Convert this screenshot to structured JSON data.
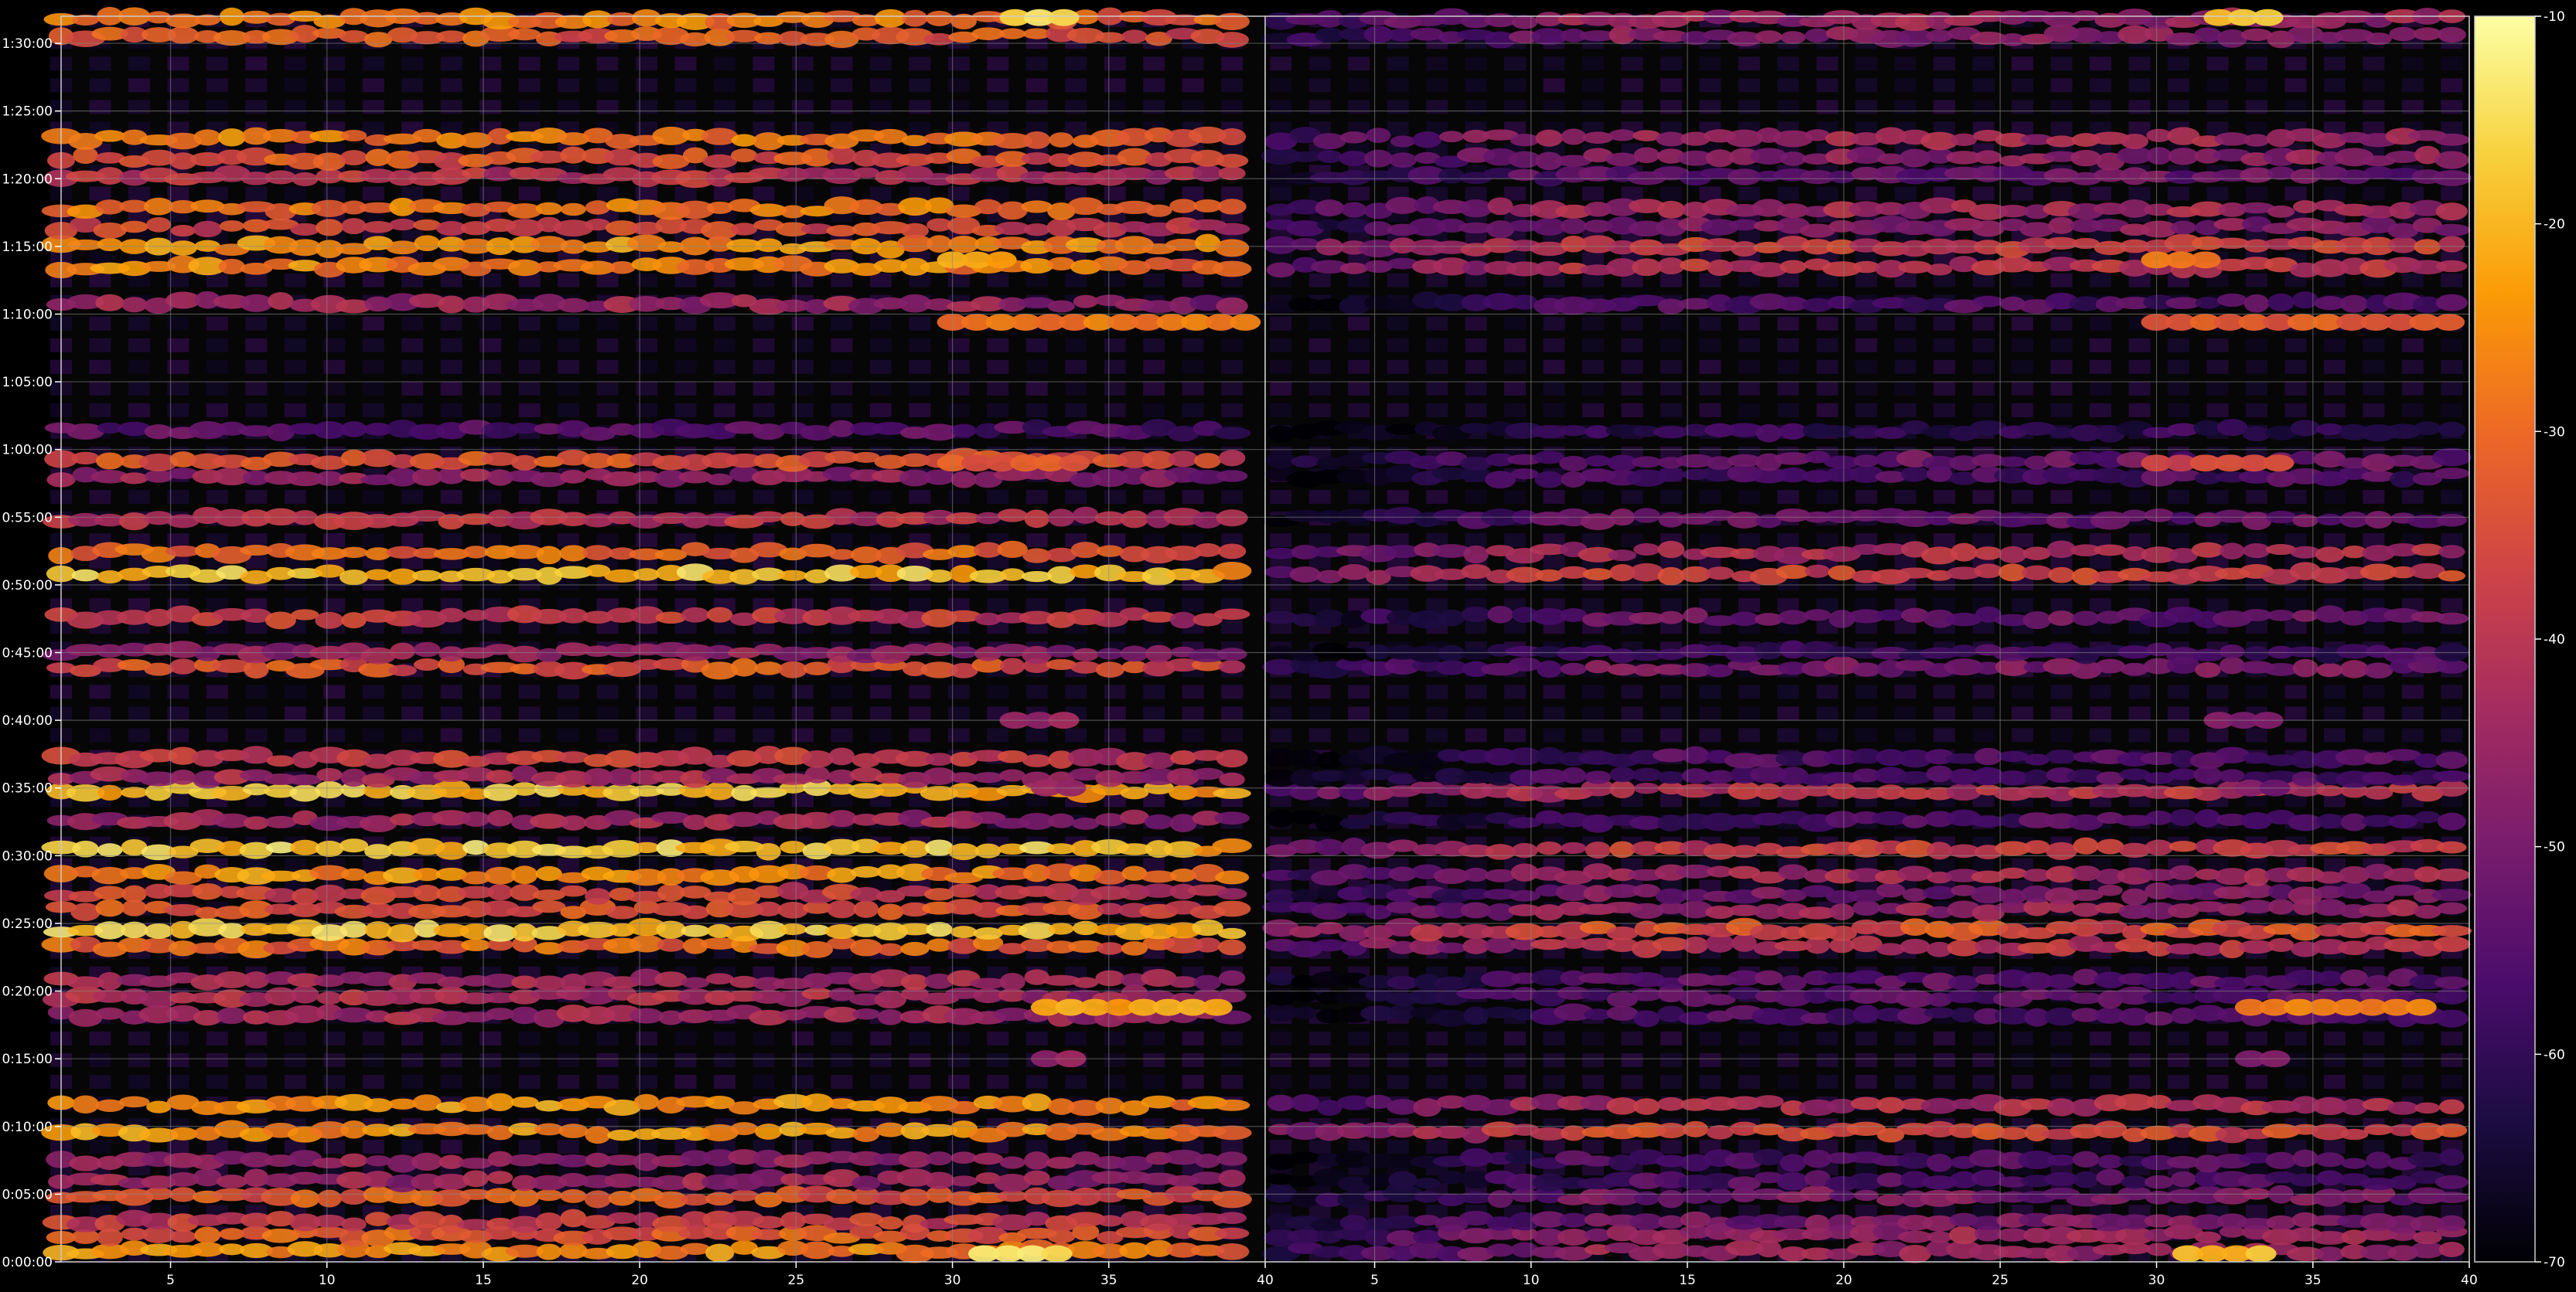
{
  "chart_data": {
    "type": "heatmap",
    "title": "",
    "xlabel": "",
    "ylabel": "",
    "grid": true,
    "colormap": [
      "#000004",
      "#1b0c41",
      "#4a0c6b",
      "#781c6d",
      "#a52c60",
      "#cf4446",
      "#ed6925",
      "#fb9b06",
      "#f7d13d",
      "#fcffa4"
    ],
    "background_color": "#000000",
    "grid_color": "#888888",
    "time_ticks": [
      "0:00:00",
      "0:05:00",
      "0:10:00",
      "0:15:00",
      "0:20:00",
      "0:25:00",
      "0:30:00",
      "0:35:00",
      "0:40:00",
      "0:45:00",
      "0:50:00",
      "0:55:00",
      "1:00:00",
      "1:05:00",
      "1:10:00",
      "1:15:00",
      "1:20:00",
      "1:25:00",
      "1:30:00"
    ],
    "time_range_minutes": [
      0,
      92
    ],
    "panels": [
      {
        "name": "left",
        "x_range": [
          1.5,
          40
        ],
        "x_ticks": [
          "5",
          "10",
          "15",
          "20",
          "25",
          "30",
          "35",
          "40"
        ],
        "active_range": [
          1.5,
          39.5
        ]
      },
      {
        "name": "right",
        "x_range": [
          1.5,
          40
        ],
        "x_ticks": [
          "5",
          "10",
          "15",
          "20",
          "25",
          "30",
          "35",
          "40"
        ],
        "active_range": [
          2,
          39.5
        ]
      }
    ],
    "colorbar": {
      "range": [
        -70,
        -10
      ],
      "ticks": [
        "-70",
        "-60",
        "-50",
        "-40",
        "-30",
        "-20",
        "-10"
      ]
    },
    "bands": [
      {
        "t": 0.8,
        "left": -25,
        "right": -45
      },
      {
        "t": 2.0,
        "left": -32,
        "right": -45
      },
      {
        "t": 3.0,
        "left": -38,
        "right": -50
      },
      {
        "t": 4.8,
        "left": -33,
        "right": -50
      },
      {
        "t": 6.0,
        "left": -45,
        "right": -56
      },
      {
        "t": 7.5,
        "left": -46,
        "right": -56
      },
      {
        "t": 9.6,
        "left": -24,
        "right": -36
      },
      {
        "t": 11.6,
        "left": -24,
        "right": -42
      },
      {
        "t": 18.2,
        "left": -44,
        "right": -56
      },
      {
        "t": 19.6,
        "left": -42,
        "right": -54
      },
      {
        "t": 20.8,
        "left": -43,
        "right": -54
      },
      {
        "t": 23.3,
        "left": -30,
        "right": -40
      },
      {
        "t": 24.5,
        "left": -17,
        "right": -34
      },
      {
        "t": 26.0,
        "left": -33,
        "right": -45
      },
      {
        "t": 27.2,
        "left": -37,
        "right": -50
      },
      {
        "t": 28.6,
        "left": -25,
        "right": -44
      },
      {
        "t": 30.5,
        "left": -17,
        "right": -38
      },
      {
        "t": 32.6,
        "left": -44,
        "right": -56
      },
      {
        "t": 34.8,
        "left": -19,
        "right": -40
      },
      {
        "t": 35.8,
        "left": -43,
        "right": -56
      },
      {
        "t": 37.2,
        "left": -38,
        "right": -56
      },
      {
        "t": 43.9,
        "left": -33,
        "right": -50
      },
      {
        "t": 45.0,
        "left": -46,
        "right": -58
      },
      {
        "t": 47.6,
        "left": -38,
        "right": -52
      },
      {
        "t": 50.8,
        "left": -18,
        "right": -37
      },
      {
        "t": 52.4,
        "left": -30,
        "right": -42
      },
      {
        "t": 54.9,
        "left": -40,
        "right": -52
      },
      {
        "t": 58.0,
        "left": -46,
        "right": -56
      },
      {
        "t": 59.2,
        "left": -34,
        "right": -52
      },
      {
        "t": 61.4,
        "left": -54,
        "right": -60
      },
      {
        "t": 70.8,
        "left": -45,
        "right": -56
      },
      {
        "t": 73.5,
        "left": -26,
        "right": -40
      },
      {
        "t": 75.0,
        "left": -24,
        "right": -38
      },
      {
        "t": 76.4,
        "left": -36,
        "right": -48
      },
      {
        "t": 77.8,
        "left": -28,
        "right": -44
      },
      {
        "t": 80.2,
        "left": -40,
        "right": -52
      },
      {
        "t": 81.5,
        "left": -33,
        "right": -47
      },
      {
        "t": 83.0,
        "left": -27,
        "right": -44
      },
      {
        "t": 90.5,
        "left": -32,
        "right": -48
      },
      {
        "t": 91.8,
        "left": -28,
        "right": -45
      }
    ],
    "spots": [
      {
        "t": 69.4,
        "x0": 30,
        "x1": 39.5,
        "value": -28,
        "panels": "both"
      },
      {
        "t": 74.0,
        "x0": 30,
        "x1": 32,
        "value": -22,
        "panels": "both"
      },
      {
        "t": 91.9,
        "x0": 32,
        "x1": 34,
        "value": -14,
        "panels": "both"
      },
      {
        "t": 0.6,
        "x0": 31,
        "x1": 34,
        "value": -15,
        "panels": "both"
      },
      {
        "t": 18.8,
        "x0": 33,
        "x1": 39,
        "value": -22,
        "panels": "both"
      },
      {
        "t": 59.0,
        "x0": 30,
        "x1": 34,
        "value": -33,
        "panels": "both"
      },
      {
        "t": 40.0,
        "x0": 32,
        "x1": 34,
        "value": -44,
        "panels": "both"
      },
      {
        "t": 15.0,
        "x0": 33,
        "x1": 34,
        "value": -46,
        "panels": "both"
      },
      {
        "t": 35.0,
        "x0": 33,
        "x1": 34,
        "value": -46,
        "panels": "both"
      }
    ]
  }
}
